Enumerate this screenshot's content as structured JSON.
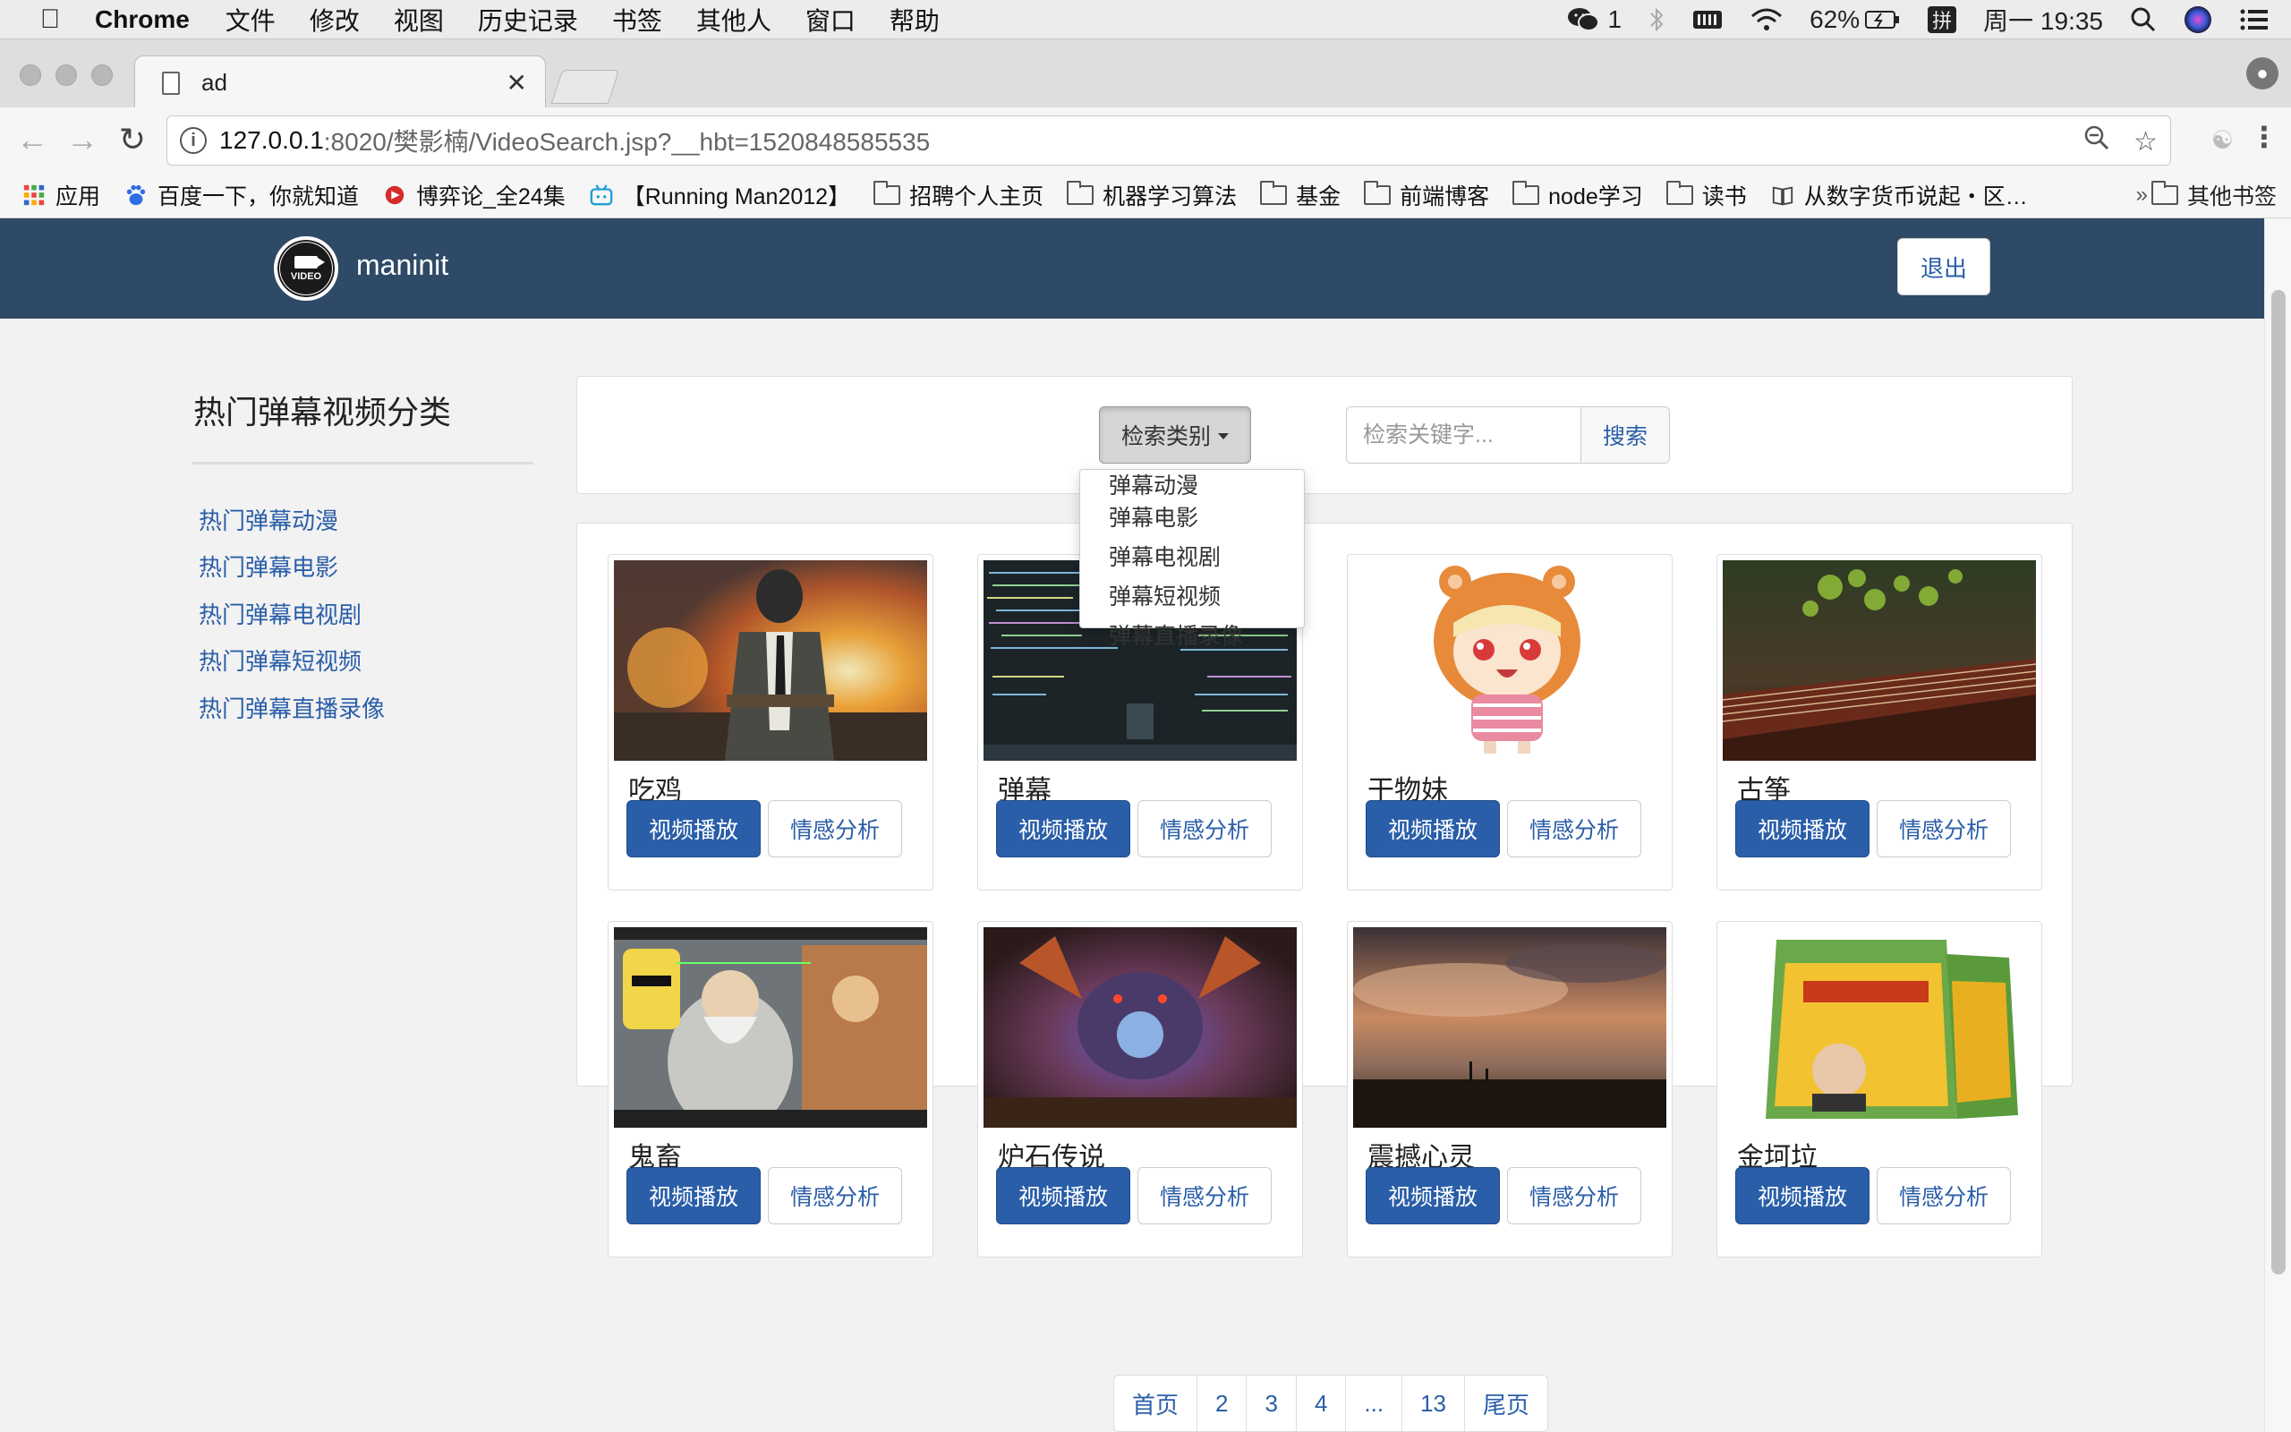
{
  "menubar": {
    "app": "Chrome",
    "items": [
      "文件",
      "修改",
      "视图",
      "历史记录",
      "书签",
      "其他人",
      "窗口",
      "帮助"
    ],
    "wechat_count": "1",
    "battery": "62%",
    "input_method": "拼",
    "clock": "周一 19:35"
  },
  "tab": {
    "title": "ad"
  },
  "address": {
    "host": "127.0.0.1",
    "rest": ":8020/樊影楠/VideoSearch.jsp?__hbt=1520848585535"
  },
  "bookmarks": {
    "items": [
      {
        "label": "应用",
        "icon": "apps-grid-icon"
      },
      {
        "label": "百度一下，你就知道",
        "icon": "baidu-paw-icon"
      },
      {
        "label": "博弈论_全24集",
        "icon": "youku-icon"
      },
      {
        "label": "【Running Man2012】",
        "icon": "bilibili-icon"
      },
      {
        "label": "招聘个人主页",
        "icon": "folder-icon"
      },
      {
        "label": "机器学习算法",
        "icon": "folder-icon"
      },
      {
        "label": "基金",
        "icon": "folder-icon"
      },
      {
        "label": "前端博客",
        "icon": "folder-icon"
      },
      {
        "label": "node学习",
        "icon": "folder-icon"
      },
      {
        "label": "读书",
        "icon": "folder-icon"
      },
      {
        "label": "从数字货币说起・区…",
        "icon": "book-icon"
      }
    ],
    "more": "»",
    "others": "其他书签"
  },
  "navbar": {
    "brand": "maninit",
    "logo_text": "VIDEO",
    "logout": "退出"
  },
  "sidebar": {
    "title": "热门弹幕视频分类",
    "links": [
      "热门弹幕动漫",
      "热门弹幕电影",
      "热门弹幕电视剧",
      "热门弹幕短视频",
      "热门弹幕直播录像"
    ]
  },
  "search": {
    "category_label": "检索类别",
    "placeholder": "检索关键字...",
    "button": "搜索",
    "dropdown": [
      "弹幕动漫",
      "弹幕电影",
      "弹幕电视剧",
      "弹幕短视频",
      "弹幕直播录像"
    ]
  },
  "videos": [
    {
      "name": "吃鸡",
      "play": "视频播放",
      "analyze": "情感分析"
    },
    {
      "name": "弹幕",
      "play": "视频播放",
      "analyze": "情感分析"
    },
    {
      "name": "干物妹",
      "play": "视频播放",
      "analyze": "情感分析"
    },
    {
      "name": "古筝",
      "play": "视频播放",
      "analyze": "情感分析"
    },
    {
      "name": "鬼畜",
      "play": "视频播放",
      "analyze": "情感分析"
    },
    {
      "name": "炉石传说",
      "play": "视频播放",
      "analyze": "情感分析"
    },
    {
      "name": "震撼心灵",
      "play": "视频播放",
      "analyze": "情感分析"
    },
    {
      "name": "金坷垃",
      "play": "视频播放",
      "analyze": "情感分析"
    }
  ],
  "pagination": [
    "首页",
    "2",
    "3",
    "4",
    "...",
    "13",
    "尾页"
  ],
  "colors": {
    "navbar": "#2e4a66",
    "primary": "#2a5ea8",
    "link": "#2a5ea8"
  }
}
